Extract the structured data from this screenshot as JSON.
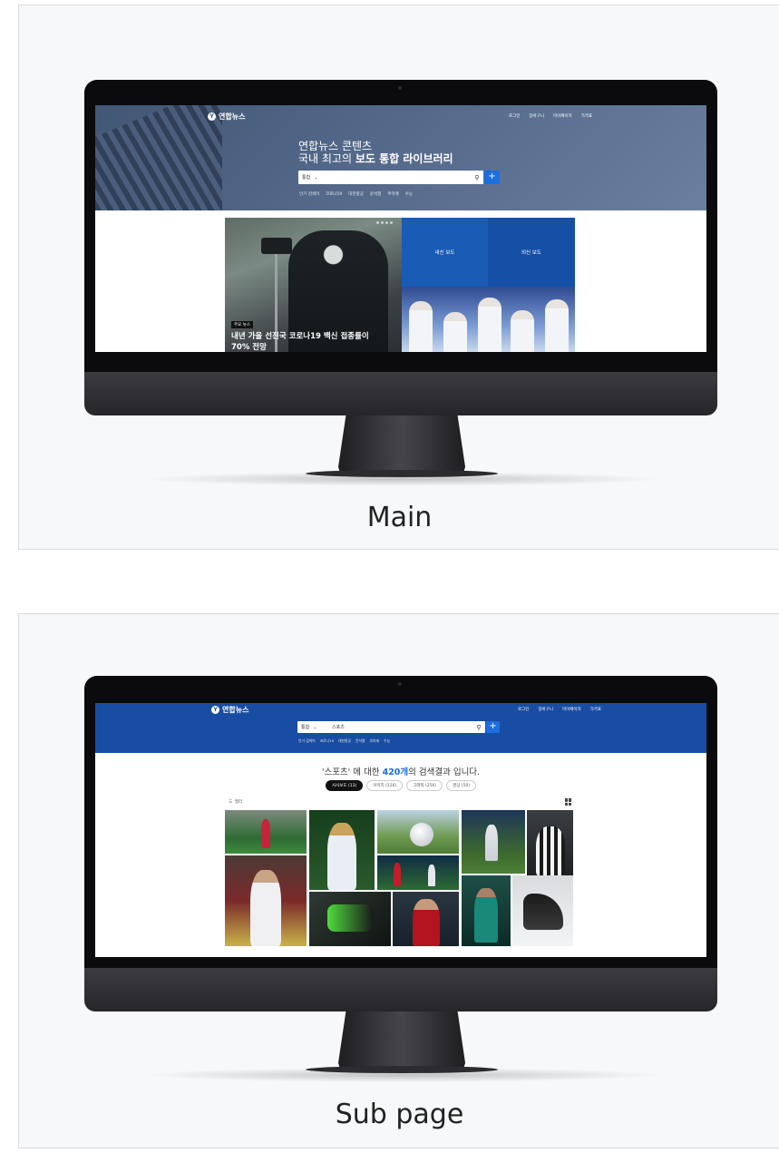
{
  "captions": {
    "main": "Main",
    "sub": "Sub page"
  },
  "site": {
    "logo_text": "연합뉴스",
    "nav": [
      "로그인",
      "장바구니",
      "마이페이지",
      "가격표"
    ]
  },
  "main_page": {
    "hero_line1": "연합뉴스 콘텐츠",
    "hero_line2_plain": "국내 최고의 ",
    "hero_line2_bold": "보도 통합 라이브러리",
    "search_select": "통합",
    "search_plus": "+",
    "tags": [
      "인기 검색어",
      "코로나19",
      "대한항공",
      "윤석열",
      "추미애",
      "수능"
    ],
    "news_badge": "주요 뉴스",
    "news_title_line1": "내년 가을 선진국 코로나19 백신 접종률이",
    "news_title_line2": "70% 전망",
    "tile_domestic": "내신 보도",
    "tile_foreign": "외신 보도"
  },
  "sub_page": {
    "search_select": "통합",
    "search_value": "스포츠",
    "search_plus": "+",
    "tags": [
      "인기 검색어",
      "코로나19",
      "대한항공",
      "윤석열",
      "추미애",
      "수능"
    ],
    "result_prefix": "'스포츠' 에 대한 ",
    "result_count": "420개",
    "result_suffix": "의 검색결과 입니다.",
    "tabs": [
      "사사보도 (13)",
      "이미지 (126)",
      "그래픽 (256)",
      "영상 (50)"
    ],
    "filter_label": "필터"
  },
  "colors": {
    "hero_blue": "#4f6584",
    "sub_header_blue": "#184da3",
    "accent_blue": "#1b6fe0",
    "bezel": "#0b0b0d"
  }
}
